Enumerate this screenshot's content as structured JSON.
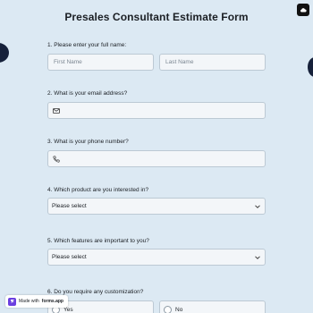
{
  "form": {
    "title": "Presales Consultant Estimate Form",
    "q1": {
      "label": "1.  Please enter your full name:",
      "first_placeholder": "First Name",
      "last_placeholder": "Last Name"
    },
    "q2": {
      "label": "2. What is your email address?",
      "icon": "mail-icon"
    },
    "q3": {
      "label": "3. What is your phone number?",
      "icon": "phone-icon"
    },
    "q4": {
      "label": "4. Which product are you interested in?",
      "selected": "Please select"
    },
    "q5": {
      "label": "5. Which features are important to you?",
      "selected": "Please select"
    },
    "q6": {
      "label": "6. Do you require any customization?",
      "options": [
        "Yes",
        "No"
      ]
    }
  },
  "badge": {
    "prefix": "Made with",
    "brand": "forms.app"
  },
  "colors": {
    "background": "#dce9f3",
    "field": "#f3f6f9",
    "border": "#bcc9d4",
    "accent": "#6b3fe0"
  }
}
